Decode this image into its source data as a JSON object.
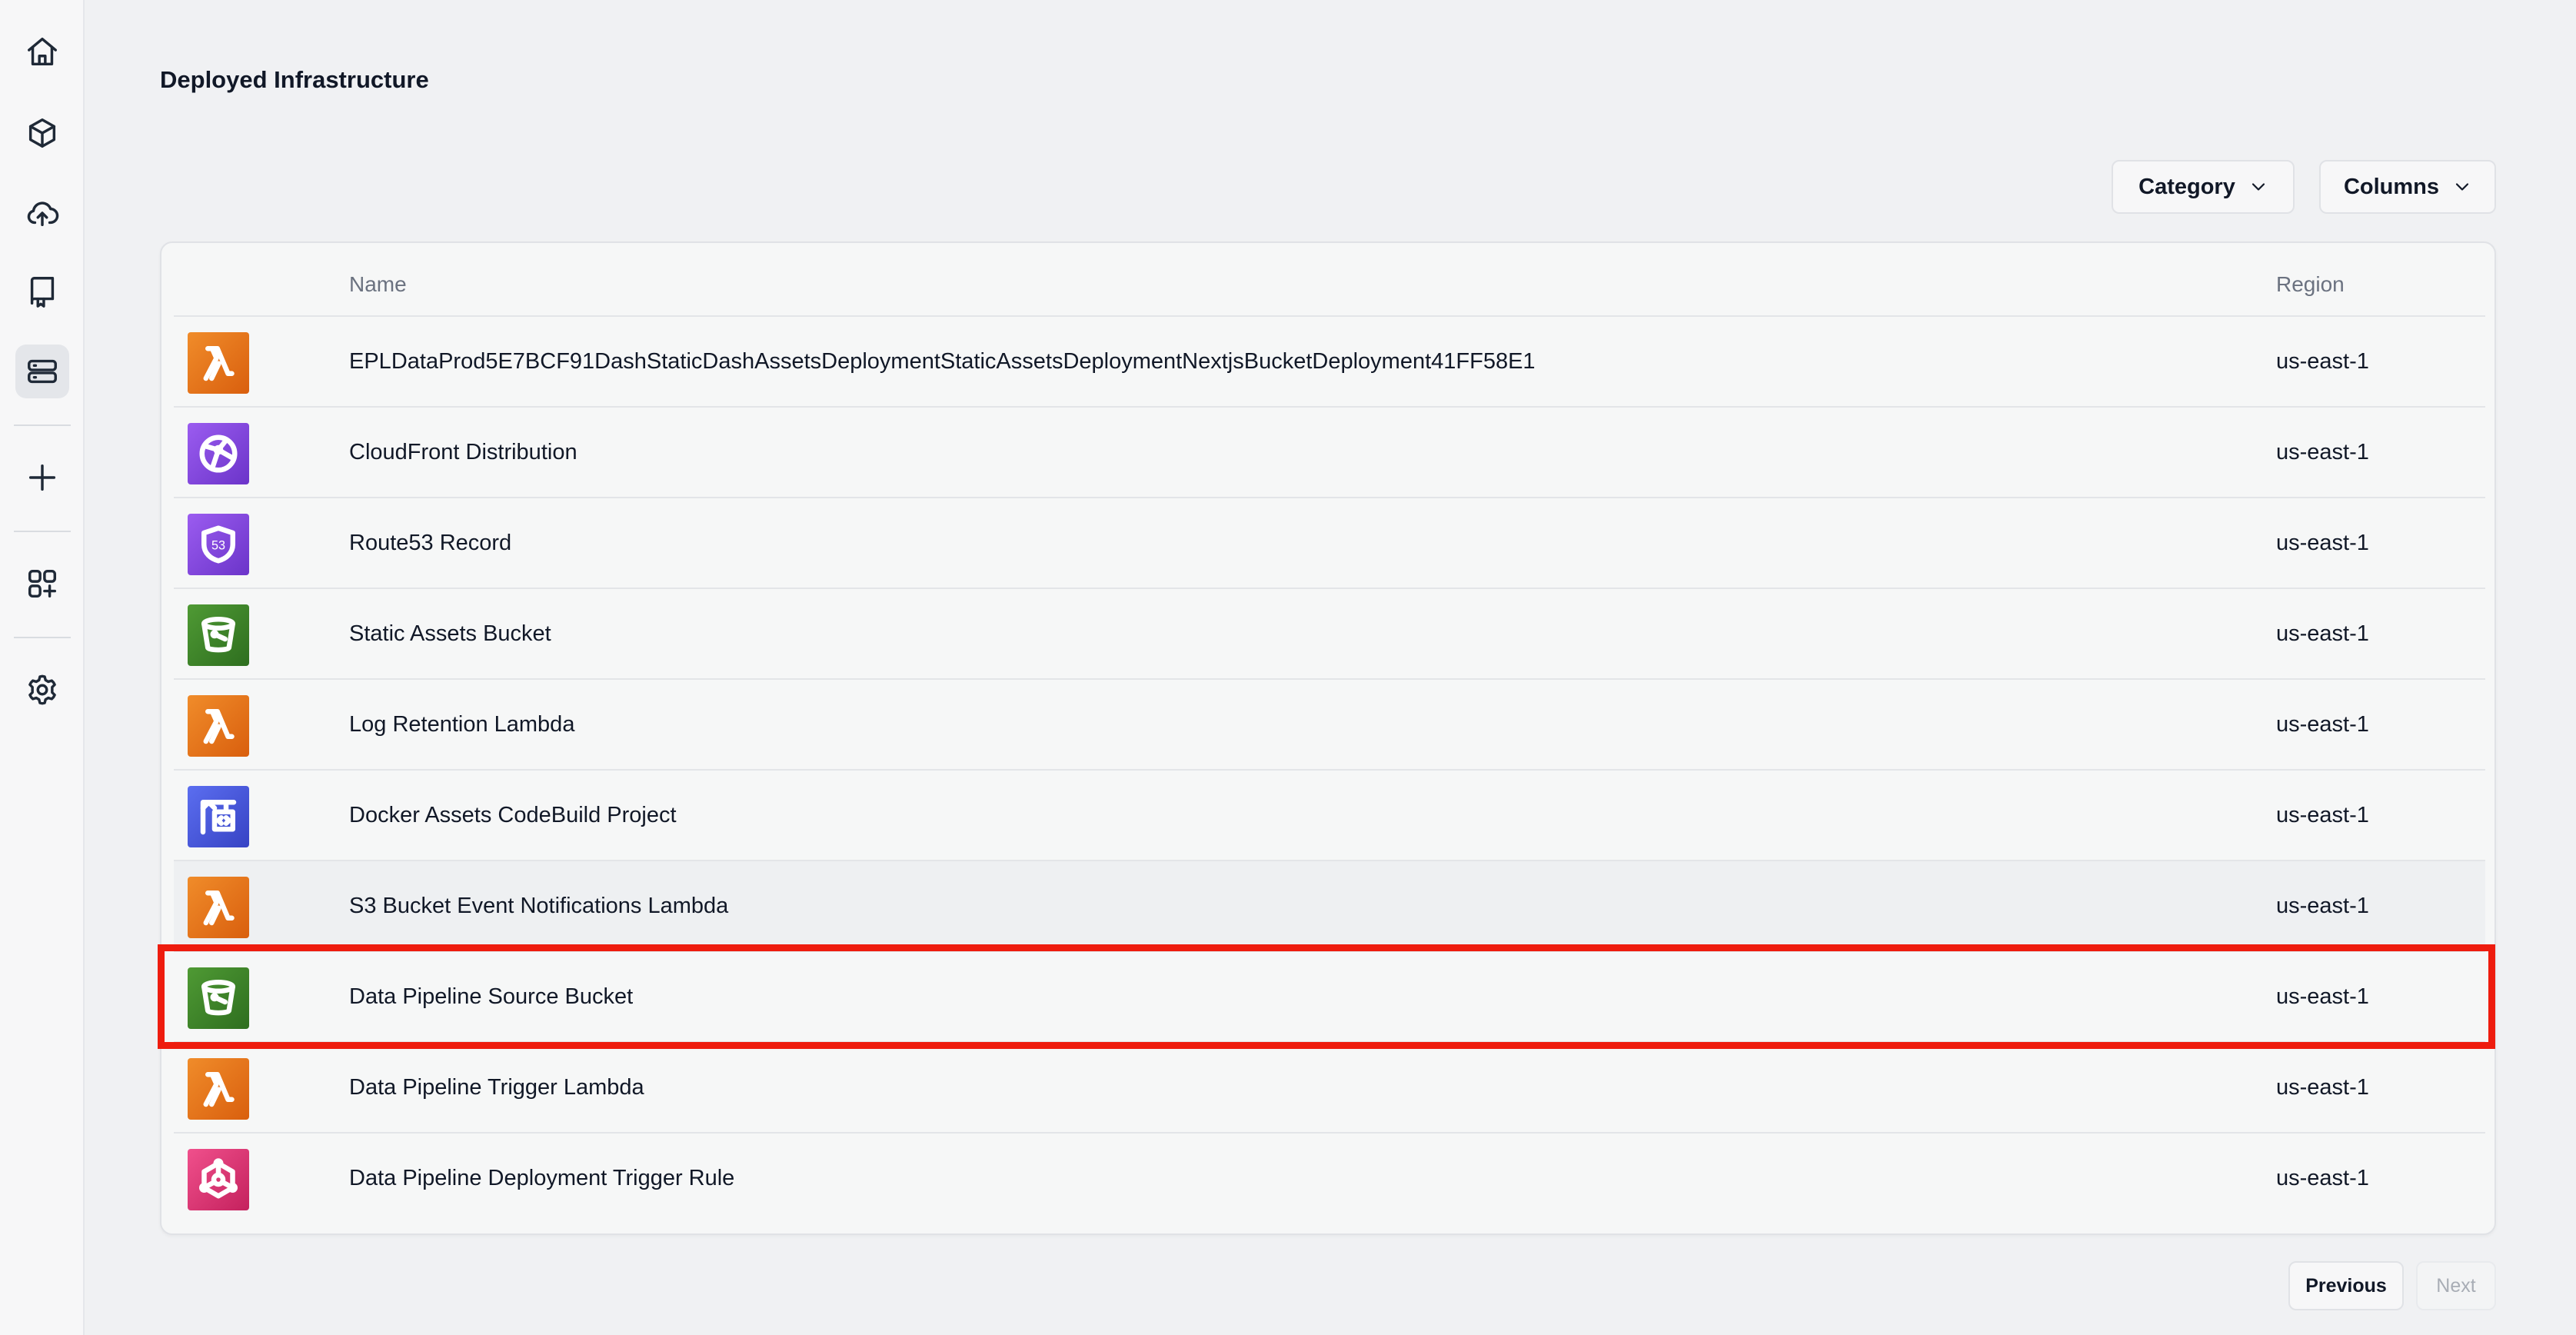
{
  "page": {
    "title": "Deployed Infrastructure"
  },
  "sidebar": {
    "items": [
      {
        "icon": "home-icon",
        "active": false
      },
      {
        "icon": "cube-icon",
        "active": false
      },
      {
        "icon": "cloud-upload-icon",
        "active": false
      },
      {
        "icon": "bookmark-book-icon",
        "active": false
      },
      {
        "icon": "database-icon",
        "active": true
      },
      {
        "icon": "plus-icon",
        "active": false
      },
      {
        "icon": "apps-add-icon",
        "active": false
      },
      {
        "icon": "gear-icon",
        "active": false
      }
    ]
  },
  "toolbar": {
    "category_label": "Category",
    "columns_label": "Columns"
  },
  "table": {
    "columns": {
      "name": "Name",
      "region": "Region"
    },
    "rows": [
      {
        "icon": "aws-lambda-icon",
        "name": "EPLDataProd5E7BCF91DashStaticDashAssetsDeploymentStaticAssetsDeploymentNextjsBucketDeployment41FF58E1",
        "region": "us-east-1"
      },
      {
        "icon": "aws-cloudfront-icon",
        "name": "CloudFront Distribution",
        "region": "us-east-1"
      },
      {
        "icon": "aws-route53-icon",
        "name": "Route53 Record",
        "region": "us-east-1",
        "icon_text": "53"
      },
      {
        "icon": "aws-s3-bucket-icon",
        "name": "Static Assets Bucket",
        "region": "us-east-1"
      },
      {
        "icon": "aws-lambda-icon",
        "name": "Log Retention Lambda",
        "region": "us-east-1"
      },
      {
        "icon": "aws-codebuild-icon",
        "name": "Docker Assets CodeBuild Project",
        "region": "us-east-1"
      },
      {
        "icon": "aws-lambda-icon",
        "name": "S3 Bucket Event Notifications Lambda",
        "region": "us-east-1",
        "hovered": true
      },
      {
        "icon": "aws-s3-bucket-icon",
        "name": "Data Pipeline Source Bucket",
        "region": "us-east-1",
        "highlighted": true
      },
      {
        "icon": "aws-lambda-icon",
        "name": "Data Pipeline Trigger Lambda",
        "region": "us-east-1"
      },
      {
        "icon": "aws-eventbridge-icon",
        "name": "Data Pipeline Deployment Trigger Rule",
        "region": "us-east-1"
      }
    ]
  },
  "pagination": {
    "previous_label": "Previous",
    "next_label": "Next",
    "next_enabled": false
  },
  "colors": {
    "highlight": "#ee1c0e",
    "lambda": "#e8731c",
    "s3": "#3f8428",
    "network": "#8247e5",
    "codebuild": "#4a58dc",
    "eventbridge": "#e23779"
  }
}
